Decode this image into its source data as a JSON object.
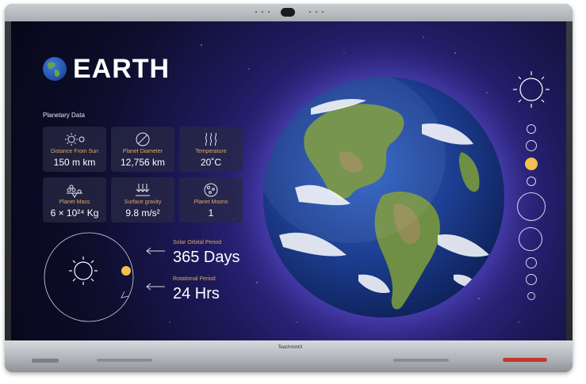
{
  "device": {
    "brand": "TeachmintX"
  },
  "title": "EARTH",
  "section_label": "Planetary Data",
  "cards": [
    {
      "label": "Distance From Sun",
      "value": "150 m km",
      "icon": "sun-planet-icon"
    },
    {
      "label": "Planet Diameter",
      "value": "12,756 km",
      "icon": "diameter-icon"
    },
    {
      "label": "Temperature",
      "value": "20˚C",
      "icon": "heat-waves-icon"
    },
    {
      "label": "Planet Mass",
      "value": "6 × 10²⁴ Kg",
      "icon": "scale-icon"
    },
    {
      "label": "Surface gravity",
      "value": "9.8 m/s²",
      "icon": "gravity-arrows-icon"
    },
    {
      "label": "Planet Moons",
      "value": "1",
      "icon": "moon-icon"
    }
  ],
  "stats": {
    "orbital": {
      "label": "Solar Orbital Period",
      "value": "365 Days"
    },
    "rotational": {
      "label": "Rotational Period",
      "value": "24 Hrs"
    }
  },
  "planet_nav": {
    "active_index": 3,
    "count": 10
  },
  "colors": {
    "accent": "#f2c14e",
    "label": "#e2a95b",
    "background": "#0e0d2b"
  }
}
